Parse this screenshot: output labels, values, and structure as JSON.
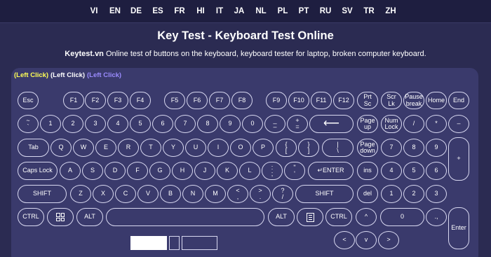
{
  "languages": [
    "VI",
    "EN",
    "DE",
    "ES",
    "FR",
    "HI",
    "IT",
    "JA",
    "NL",
    "PL",
    "PT",
    "RU",
    "SV",
    "TR",
    "ZH"
  ],
  "title": "Key Test - Keyboard Test Online",
  "description": {
    "brand": "Keytest.vn",
    "text": " Online test of buttons on the keyboard, keyboard tester for laptop, broken computer keyboard."
  },
  "mouse_clicks": [
    {
      "label": "(Left Click)",
      "color": "#ffff55"
    },
    {
      "label": "(Left Click)",
      "color": "#ffffff"
    },
    {
      "label": "(Left Click)",
      "color": "#9b8cff"
    }
  ],
  "keys": {
    "esc": "Esc",
    "f1": "F1",
    "f2": "F2",
    "f3": "F3",
    "f4": "F4",
    "f5": "F5",
    "f6": "F6",
    "f7": "F7",
    "f8": "F8",
    "f9": "F9",
    "f10": "F10",
    "f11": "F11",
    "f12": "F12",
    "prtsc": "Prt\nSc",
    "scrlk": "Scr\nLk",
    "pause": "Pause\nbreak",
    "home": "Home",
    "end": "End",
    "backquote": "~\n`",
    "d1": "1",
    "d2": "2",
    "d3": "3",
    "d4": "4",
    "d5": "5",
    "d6": "6",
    "d7": "7",
    "d8": "8",
    "d9": "9",
    "d0": "0",
    "minus": "_\n–",
    "equal": "+\n=",
    "backspace": "⟵",
    "pgup": "Page\nup",
    "numlock": "Num\nLock",
    "numdiv": "/",
    "nummul": "*",
    "numsub": "–",
    "tab": "Tab",
    "q": "Q",
    "w": "W",
    "e": "E",
    "r": "R",
    "t": "T",
    "y": "Y",
    "u": "U",
    "i": "I",
    "o": "O",
    "p": "P",
    "lbracket": "{\n[",
    "rbracket": "}\n]",
    "backslash": "|\n\\",
    "pgdn": "Page\ndown",
    "n7": "7",
    "n8": "8",
    "n9": "9",
    "numadd": "+",
    "caps": "Caps Lock",
    "a": "A",
    "s": "S",
    "d": "D",
    "f": "F",
    "g": "G",
    "h": "H",
    "j": "J",
    "k": "K",
    "l": "L",
    "semicolon": ":\n;",
    "quote": "\"\n'",
    "enter": "↵ENTER",
    "ins": "ins",
    "n4": "4",
    "n5": "5",
    "n6": "6",
    "lshift": "SHIFT",
    "z": "Z",
    "x": "X",
    "c": "C",
    "v": "V",
    "b": "B",
    "n": "N",
    "m": "M",
    "comma": "<\n,",
    "period": ">\n.",
    "slash": "?\n/",
    "rshift": "SHIFT",
    "del": "del",
    "n1": "1",
    "n2": "2",
    "n3": "3",
    "lctrl": "CTRL",
    "lalt": "ALT",
    "space": "",
    "ralt": "ALT",
    "rctrl": "CTRL",
    "up": "^",
    "n0": "0",
    "numdot": ".,",
    "numenter": "Enter",
    "left": "<",
    "down": "v",
    "right": ">"
  }
}
